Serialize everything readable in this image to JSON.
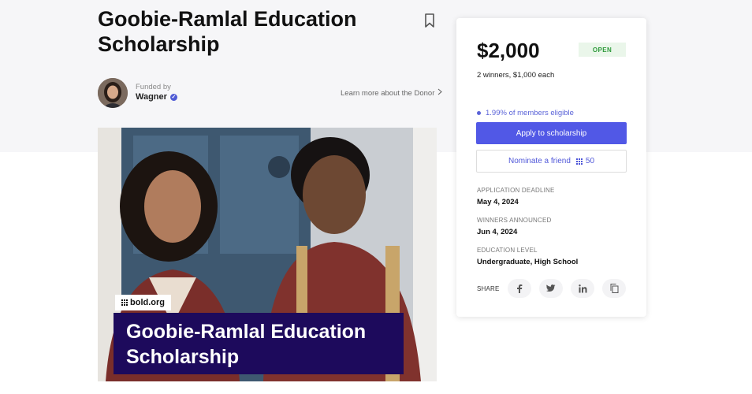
{
  "page": {
    "title": "Goobie-Ramlal Education Scholarship"
  },
  "donor": {
    "funded_by_label": "Funded by",
    "name": "Wagner",
    "learn_more": "Learn more about the Donor"
  },
  "hero": {
    "logo_text": "bold.org",
    "title": "Goobie-Ramlal Education Scholarship"
  },
  "card": {
    "amount": "$2,000",
    "status": "OPEN",
    "winners": "2 winners, $1,000 each",
    "eligibility": "1.99% of members eligible",
    "apply_label": "Apply to scholarship",
    "nominate_label": "Nominate a friend",
    "nominate_count": "50",
    "details": [
      {
        "label": "APPLICATION DEADLINE",
        "value": "May 4, 2024"
      },
      {
        "label": "WINNERS ANNOUNCED",
        "value": "Jun 4, 2024"
      },
      {
        "label": "EDUCATION LEVEL",
        "value": "Undergraduate, High School"
      }
    ],
    "share_label": "SHARE",
    "share_icons": [
      "facebook-icon",
      "twitter-icon",
      "linkedin-icon",
      "copy-icon"
    ]
  },
  "colors": {
    "accent": "#5158e6",
    "open_badge_bg": "#eaf6ea",
    "open_badge_text": "#2e9a3b",
    "hero_band": "#1d0a5c"
  }
}
